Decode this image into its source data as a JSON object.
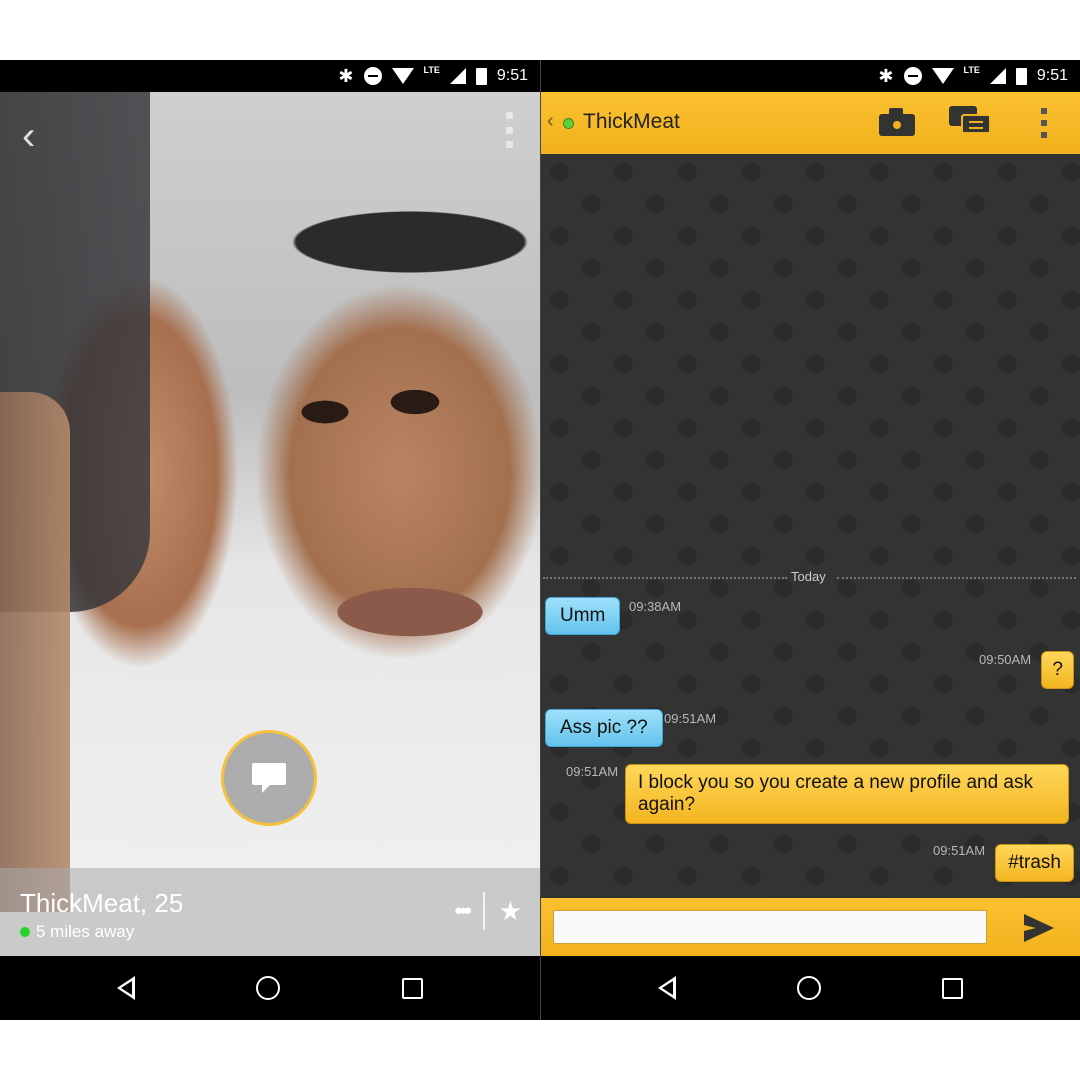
{
  "status_bar": {
    "time": "9:51",
    "network": "LTE"
  },
  "profile": {
    "name_age": "ThickMeat, 25",
    "distance": "5 miles away",
    "online": true,
    "accent_color": "#f5c23d"
  },
  "chat": {
    "contact_name": "ThickMeat",
    "date_label": "Today",
    "messages": [
      {
        "direction": "in",
        "text": "Umm",
        "time": "09:38AM"
      },
      {
        "direction": "out",
        "text": "?",
        "time": "09:50AM"
      },
      {
        "direction": "in",
        "text": "Ass pic ??",
        "time": "09:51AM"
      },
      {
        "direction": "out",
        "text": "I block you so you create a new profile and ask again?",
        "time": "09:51AM"
      },
      {
        "direction": "out",
        "text": "#trash",
        "time": "09:51AM"
      }
    ],
    "input_value": "",
    "colors": {
      "bar": "#f2b11e",
      "incoming_bubble": "#63c3ec",
      "outgoing_bubble": "#f3b51f",
      "background": "#333333"
    }
  },
  "icons": {
    "status": [
      "bluetooth-icon",
      "do-not-disturb-icon",
      "wifi-icon",
      "signal-icon",
      "battery-icon"
    ],
    "nav": [
      "back-icon",
      "home-icon",
      "recents-icon"
    ],
    "chat_toolbar": [
      "camera-icon",
      "saved-phrases-icon",
      "overflow-menu-icon"
    ]
  }
}
